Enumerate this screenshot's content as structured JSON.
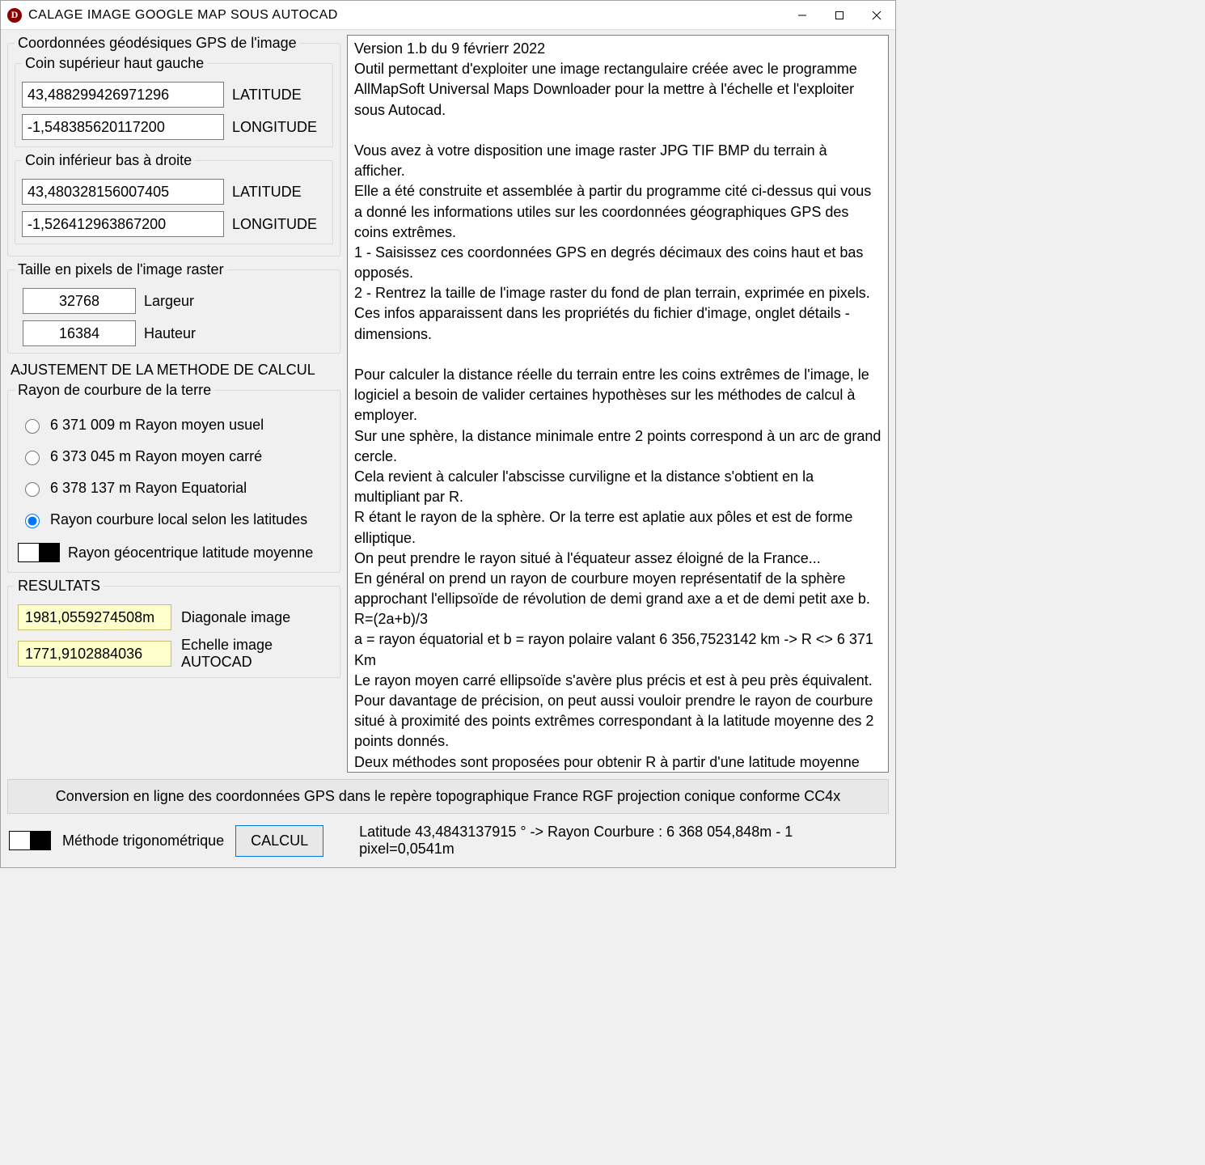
{
  "window": {
    "title": "CALAGE IMAGE GOOGLE MAP SOUS AUTOCAD"
  },
  "left": {
    "gps_group": "Coordonnées géodésiques GPS de l'image",
    "top_left_group": "Coin supérieur haut gauche",
    "bottom_right_group": "Coin inférieur bas à droite",
    "lat_label": "LATITUDE",
    "lon_label": "LONGITUDE",
    "tl_lat": "43,488299426971296",
    "tl_lon": "-1,548385620117200",
    "br_lat": "43,480328156007405",
    "br_lon": "-1,526412963867200",
    "pixels_group": "Taille en pixels de l'image raster",
    "width_label": "Largeur",
    "height_label": "Hauteur",
    "width": "32768",
    "height": "16384",
    "adjust_title": "AJUSTEMENT DE LA METHODE DE CALCUL",
    "radius_group": "Rayon de courbure de la terre",
    "radios": [
      "6 371 009 m Rayon moyen usuel",
      "6 373 045 m Rayon moyen carré",
      "6 378 137 m Rayon Equatorial",
      "Rayon courbure local selon les latitudes"
    ],
    "radio_selected": 3,
    "geocentric_toggle": "Rayon géocentrique latitude moyenne",
    "results_title": "RESULTATS",
    "diag_label": "Diagonale image",
    "diag_value": "1981,0559274508m",
    "scale_label": "Echelle image AUTOCAD",
    "scale_value": "1771,9102884036"
  },
  "info_text": "Version 1.b du 9 févrierr 2022\nOutil permettant d'exploiter une image rectangulaire créée avec le programme AllMapSoft Universal Maps Downloader pour la mettre à l'échelle et l'exploiter sous Autocad.\n\nVous avez à votre disposition une image raster JPG TIF BMP du terrain à afficher.\nElle a été construite et assemblée à partir du programme cité ci-dessus qui vous a donné les informations utiles sur les coordonnées géographiques GPS des coins extrêmes.\n1 - Saisissez ces coordonnées GPS en degrés décimaux des coins haut et bas opposés.\n2 - Rentrez la taille de l'image raster du fond de plan terrain, exprimée en pixels.\nCes infos apparaissent dans les propriétés du fichier d'image, onglet détails - dimensions.\n\nPour calculer la distance réelle du terrain entre les coins extrêmes de l'image, le logiciel a besoin de valider certaines hypothèses sur les méthodes de calcul à employer.\nSur une sphère, la distance minimale entre 2 points correspond à un arc de grand cercle.\nCela revient à calculer l'abscisse curviligne et la distance s'obtient en la multipliant par R.\nR étant le rayon de la sphère. Or la terre est aplatie aux pôles et est de forme elliptique.\nOn peut prendre le rayon situé à l'équateur assez éloigné de la France...\nEn général on prend un rayon de courbure moyen représentatif de la sphère approchant l'ellipsoïde de révolution de demi grand axe a et de demi petit axe b. R=(2a+b)/3\na = rayon équatorial et b = rayon polaire valant 6 356,7523142 km -> R <> 6 371 Km\nLe rayon moyen carré ellipsoïde s'avère plus précis et est à peu près équivalent.\nPour davantage de précision, on peut aussi vouloir prendre le rayon de courbure situé à proximité des points extrêmes correspondant à la latitude moyenne des 2 points donnés.\nDeux méthodes sont proposées pour obtenir R à partir d'une latitude moyenne Phi :\nRayon géocentrique ou Rayon de courbure local à partir de l'ellipsoïde IAG GRS 1980.\nCette ellipsoïde est associée au système géodésique WGS84 et au RGF93 en France.\nLe programme offre aussi 2 façons de calculer la diagonale S du terrain (distance réelle).\nUne méthode trigonométrique sphérique ou alors une méthode géodésique plus précise.\n\nPour attacher l'image sous l'environnement graphique de dessin Autocad, sachez que:\n- la largeur de l'image de xxxx pixels représente 1 unité de dessin Autocad.\n- la hauteur de l'image est adaptée en conséquence pour garder le même rapport.\n\nLe bouton CALCUL détermine la mesure de la diagonale de l'image raster à attacher.\nCette diagonale et la distance terrain doivent forcément correspondre entre elles.\nLe programme calcule ensuite l'échelle Autocad à appliquer à la diagonale de l'image.\nVous aurez une image attachée à l'échelle exacte pour une unité autocad valant 1m.\nEn bas de l'écran, vous aurez en info la densité métrique du pixel pour vos tolérances.",
  "bottom": {
    "conversion": "Conversion en ligne des coordonnées GPS dans le repère topographique France RGF projection conique conforme CC4x",
    "method_toggle": "Méthode trigonométrique",
    "calc_button": "CALCUL",
    "status": "Latitude 43,4843137915 ° -> Rayon Courbure : 6 368 054,848m - 1 pixel=0,0541m"
  }
}
